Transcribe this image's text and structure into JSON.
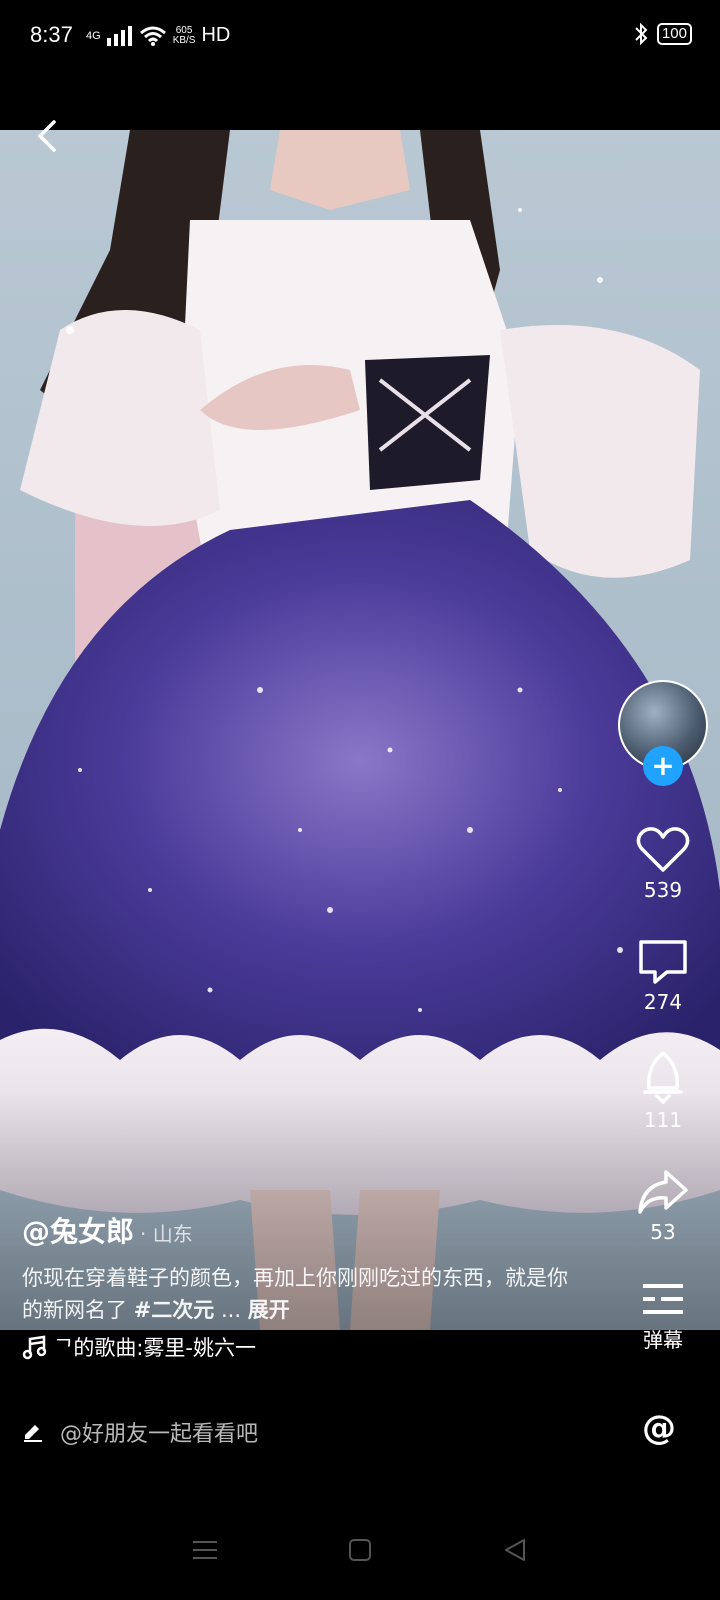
{
  "status_bar": {
    "time": "8:37",
    "network": "4G",
    "speed_value": "605",
    "speed_unit": "KB/S",
    "hd": "HD",
    "battery": "100"
  },
  "video": {
    "author": "@兔女郎",
    "location": "· 山东",
    "description": "你现在穿着鞋子的颜色，再加上你刚刚吃过的东西，就是你的新网名了",
    "hashtag": "#二次元",
    "ellipsis": "...",
    "expand_label": "展开",
    "music": "ᄀ的歌曲:雾里-姚六一"
  },
  "actions": {
    "likes": "539",
    "comments": "274",
    "shares_rocket": "111",
    "shares": "53",
    "danmaku_label": "弹幕"
  },
  "comment_bar": {
    "placeholder": "@好朋友一起看看吧",
    "at_symbol": "@"
  },
  "icons": {
    "back": "back-arrow-icon",
    "like": "heart-icon",
    "comment": "comment-bubble-icon",
    "rocket": "rocket-icon",
    "share": "share-arrow-icon",
    "danmaku": "danmaku-icon",
    "music": "music-note-icon",
    "edit": "pencil-icon",
    "at": "at-icon"
  },
  "colors": {
    "follow_blue": "#1fa3ff",
    "skirt_purple": "#4b3b9a"
  }
}
